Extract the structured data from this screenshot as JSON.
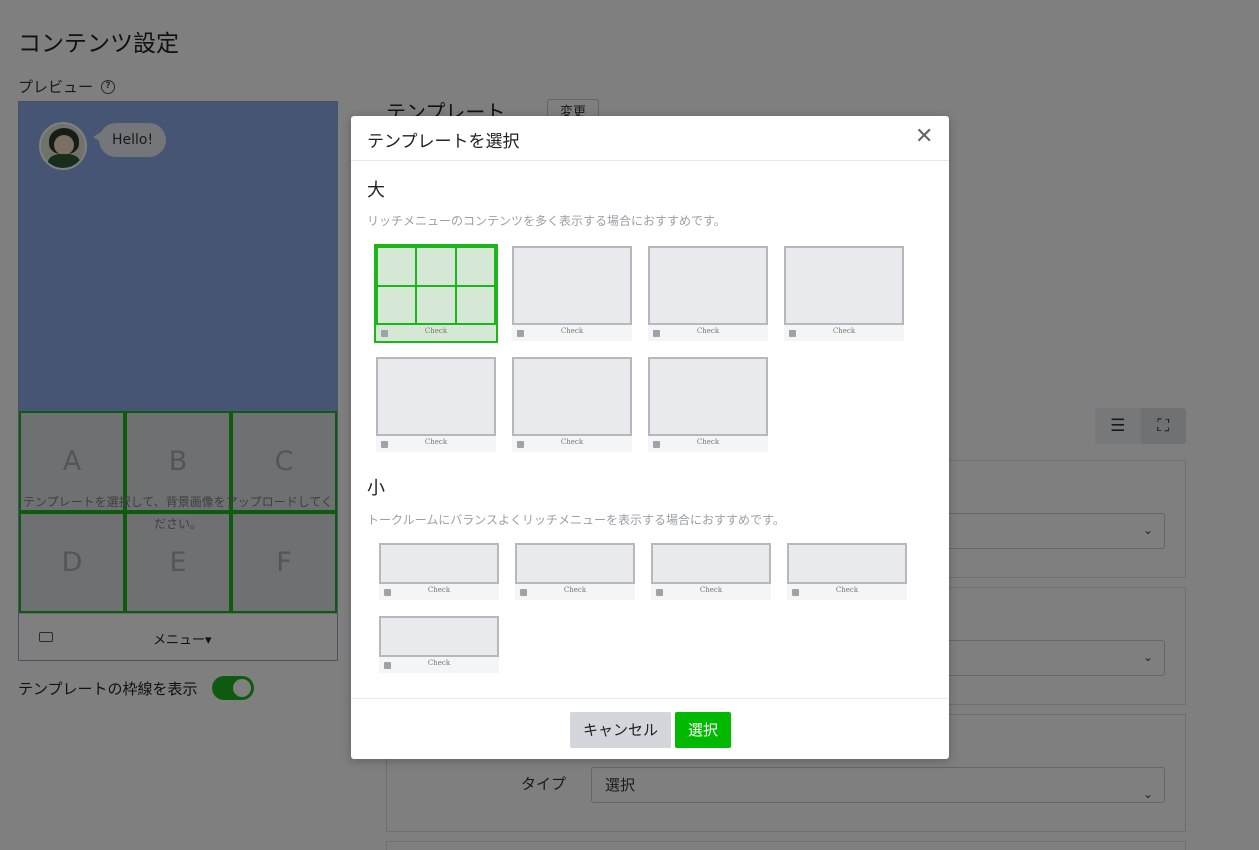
{
  "page": {
    "title": "コンテンツ設定",
    "preview_label": "プレビュー",
    "help_icon": "?",
    "chat_message": "Hello!",
    "grid_cells": [
      "A",
      "B",
      "C",
      "D",
      "E",
      "F"
    ],
    "grid_hint_line1": "テンプレートを選択して、背景画像をアップロードしてく",
    "grid_hint_line2": "ださい。",
    "menu_label": "メニュー▾",
    "toggle_label": "テンプレートの枠線を表示",
    "template_heading": "テンプレート",
    "change_button": "変更",
    "type_label": "タイプ",
    "type_select_value": "選択",
    "select_arrow": "⌄",
    "view_list_icon": "☰",
    "view_expand_icon": "⛶"
  },
  "modal": {
    "title": "テンプレートを選択",
    "close_icon": "✕",
    "large_title": "大",
    "large_desc": "リッチメニューのコンテンツを多く表示する場合におすすめです。",
    "small_title": "小",
    "small_desc": "トークルームにバランスよくリッチメニューを表示する場合におすすめです。",
    "card_footer_text": "Check",
    "cancel_label": "キャンセル",
    "select_label": "選択"
  },
  "colors": {
    "brand_green": "#00b900",
    "selected_border": "#1cb51c",
    "overlay": "rgba(0,0,0,0.5)"
  }
}
